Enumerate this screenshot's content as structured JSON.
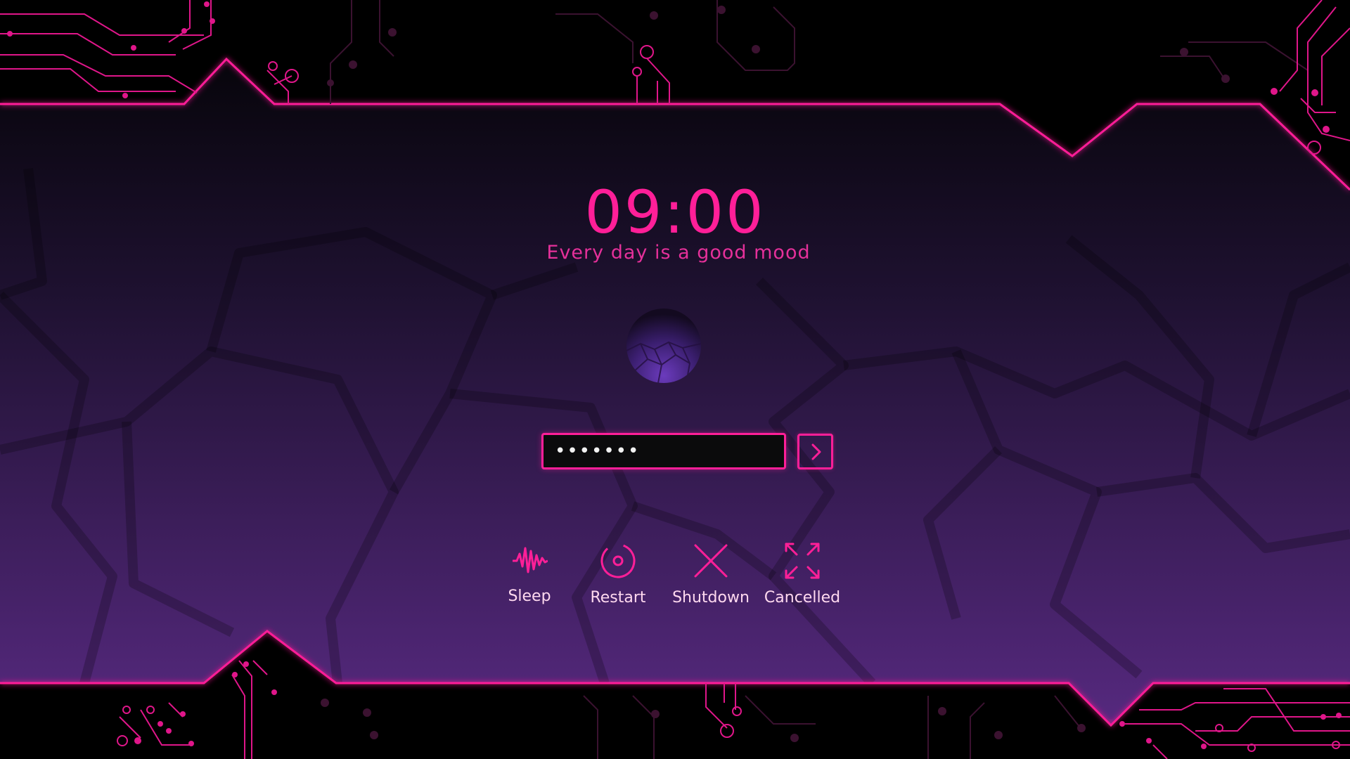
{
  "clock": {
    "time": "09:00"
  },
  "greeting": {
    "motto": "Every day is a good mood"
  },
  "login": {
    "password_value": "•••••••",
    "submit_icon": "chevron-right-icon"
  },
  "power_options": [
    {
      "label": "Sleep",
      "icon": "sleep-wave-icon"
    },
    {
      "label": "Restart",
      "icon": "restart-icon"
    },
    {
      "label": "Shutdown",
      "icon": "shutdown-x-icon"
    },
    {
      "label": "Cancelled",
      "icon": "expand-arrows-icon"
    }
  ],
  "theme": {
    "accent": "#ff1f98",
    "background_top": "#0a0710",
    "background_bottom": "#55287f",
    "frame": "#000000"
  }
}
